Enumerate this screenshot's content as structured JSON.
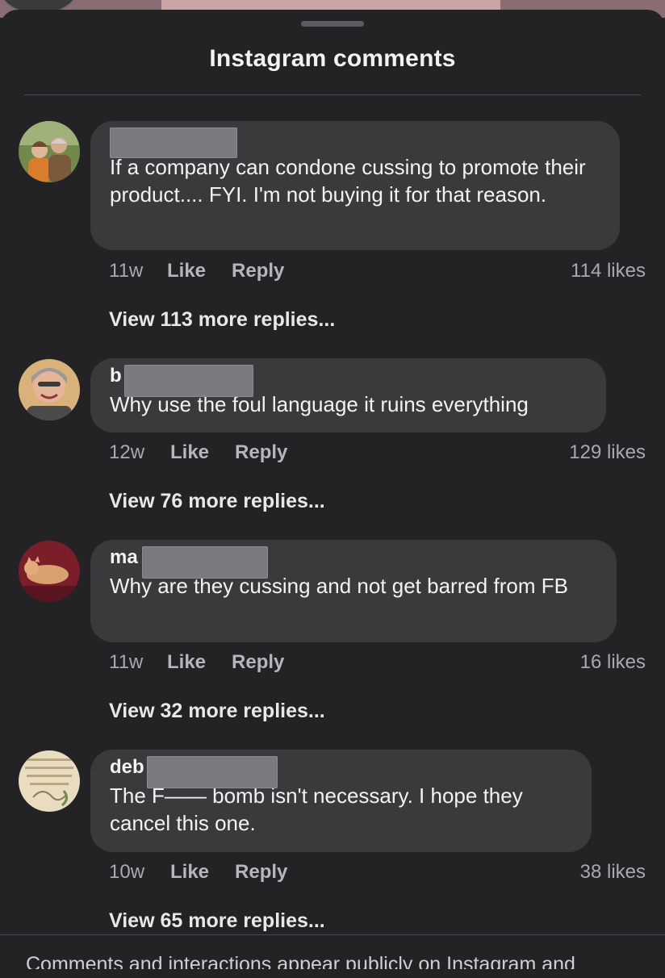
{
  "sheet": {
    "title": "Instagram comments"
  },
  "comments": [
    {
      "author": "",
      "text": "If a company can condone cussing to promote their product.... FYI. I'm not buying it for that reason.",
      "time": "11w",
      "like_label": "Like",
      "reply_label": "Reply",
      "likes": "114 likes",
      "view_replies": "View 113 more replies..."
    },
    {
      "author": "b",
      "text": "Why use the foul language it ruins everything",
      "time": "12w",
      "like_label": "Like",
      "reply_label": "Reply",
      "likes": "129 likes",
      "view_replies": "View 76 more replies..."
    },
    {
      "author": "ma",
      "text": "Why are they cussing and not get barred from FB",
      "time": "11w",
      "like_label": "Like",
      "reply_label": "Reply",
      "likes": "16 likes",
      "view_replies": "View 32 more replies..."
    },
    {
      "author": "deb",
      "text": "The F—— bomb isn't necessary. I hope they cancel this one.",
      "time": "10w",
      "like_label": "Like",
      "reply_label": "Reply",
      "likes": "38 likes",
      "view_replies": "View 65 more replies..."
    }
  ],
  "footer": {
    "note": "Comments and interactions appear publicly on Instagram and"
  },
  "colors": {
    "background": "#232325",
    "bubble": "#3a3a3c",
    "text": "#f2f2f4",
    "muted": "#a9a9ae"
  }
}
